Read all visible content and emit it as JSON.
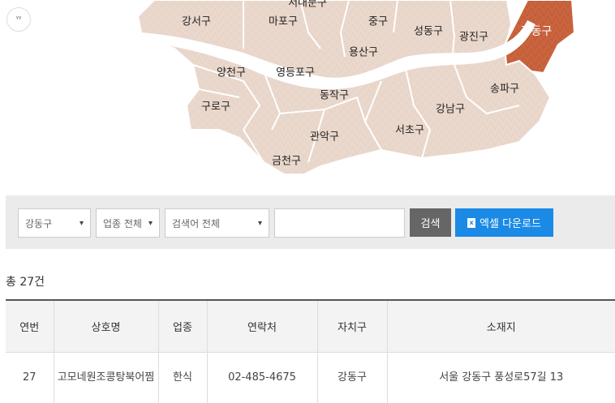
{
  "map": {
    "districts": [
      {
        "name": "서대문구",
        "label": "서대문구"
      },
      {
        "name": "강서구",
        "label": "강서구"
      },
      {
        "name": "마포구",
        "label": "마포구"
      },
      {
        "name": "중구",
        "label": "중구"
      },
      {
        "name": "성동구",
        "label": "성동구"
      },
      {
        "name": "광진구",
        "label": "광진구"
      },
      {
        "name": "강동구",
        "label": "강동구"
      },
      {
        "name": "용산구",
        "label": "용산구"
      },
      {
        "name": "양천구",
        "label": "양천구"
      },
      {
        "name": "영등포구",
        "label": "영등포구"
      },
      {
        "name": "송파구",
        "label": "송파구"
      },
      {
        "name": "동작구",
        "label": "동작구"
      },
      {
        "name": "구로구",
        "label": "구로구"
      },
      {
        "name": "강남구",
        "label": "강남구"
      },
      {
        "name": "서초구",
        "label": "서초구"
      },
      {
        "name": "관악구",
        "label": "관악구"
      },
      {
        "name": "금천구",
        "label": "금천구"
      }
    ],
    "selected": "강동구",
    "colors": {
      "district": "#ead8cd",
      "selected": "#c9643f",
      "river": "#ffffff",
      "border": "#ffffff"
    }
  },
  "search": {
    "district_select": "강동구",
    "category_select": "업종 전체",
    "keyword_select": "검색어 전체",
    "keyword_input": "",
    "search_button": "검색",
    "excel_button": "엑셀 다운로드"
  },
  "summary": {
    "prefix": "총",
    "count": "27",
    "suffix": "건"
  },
  "table": {
    "headers": [
      "연번",
      "상호명",
      "업종",
      "연락처",
      "자치구",
      "소재지"
    ],
    "rows": [
      {
        "no": "27",
        "name": "고모네원조콩탕북어찜",
        "category": "한식",
        "phone": "02-485-4675",
        "district": "강동구",
        "address": "서울 강동구 풍성로57길 13"
      }
    ]
  }
}
